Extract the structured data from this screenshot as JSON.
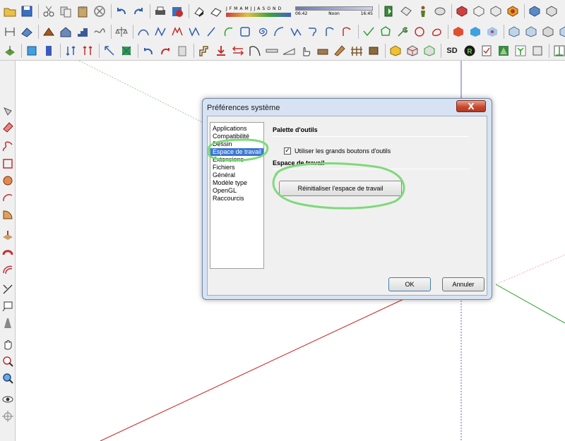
{
  "toolbar": {
    "sun_months": [
      "J",
      "F",
      "M",
      "A",
      "M",
      "J",
      "J",
      "A",
      "S",
      "O",
      "N",
      "D"
    ],
    "time_start": "06:42",
    "time_mid": "Noon",
    "time_end": "16:45",
    "sd_label": "SD",
    "r_label": "R"
  },
  "dialog": {
    "title": "Préférences système",
    "close_label": "X",
    "categories": [
      "Applications",
      "Compatibilité",
      "Dessin",
      "Espace de travail",
      "Extensions",
      "Fichiers",
      "Général",
      "Modèle type",
      "OpenGL",
      "Raccourcis"
    ],
    "selected_category": "Espace de travail",
    "section1_title": "Palette d'outils",
    "checkbox_label": "Utiliser les grands boutons d'outils",
    "checkbox_checked": "✓",
    "section2_title": "Espace de travail",
    "reset_button": "Réinitialiser l'espace de travail",
    "ok_button": "OK",
    "cancel_button": "Annuler"
  },
  "colors": {
    "axis_red": "#cc2020",
    "axis_green": "#20a020",
    "axis_blue": "#6060d0",
    "highlight_green": "#7fd97a",
    "selection_blue": "#3a77d4"
  }
}
